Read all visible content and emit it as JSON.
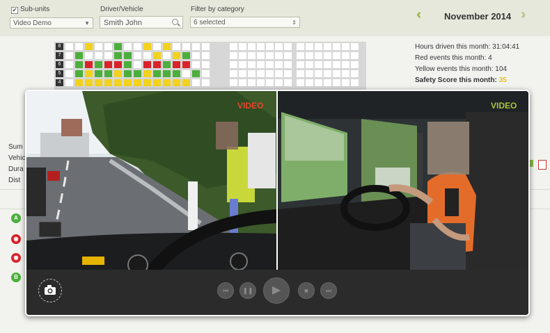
{
  "filters": {
    "subunits_label": "Sub-units",
    "subunits_checked": "✔",
    "subunits_value": "Video Demo",
    "driver_label": "Driver/Vehicle",
    "driver_value": "Smith John",
    "category_label": "Filter by category",
    "category_value": "6 selected"
  },
  "calendar": {
    "month": "November 2014",
    "row_labels": [
      "8",
      "7",
      "6",
      "5",
      "4"
    ]
  },
  "stats": {
    "hours_label": "Hours driven this month:",
    "hours_value": "31:04:41",
    "red_label": "Red events this month:",
    "red_value": "4",
    "yellow_label": "Yellow events this month:",
    "yellow_value": "104",
    "safety_label": "Safety Score this month:",
    "safety_value": "35"
  },
  "summary": {
    "labels": [
      "Sum",
      "Vehic",
      "Dura",
      "Dist"
    ]
  },
  "events": {
    "badges": [
      "A",
      "",
      "",
      "B"
    ]
  },
  "player": {
    "left_label": "VIDEO",
    "right_label": "VIDEO"
  },
  "colors": {
    "green": "#4caf3c",
    "red": "#d8232a",
    "yellow": "#f2d21c",
    "accent": "#9cb84a",
    "video_left_label": "#e8452a",
    "video_right_label": "#a8c43a"
  }
}
